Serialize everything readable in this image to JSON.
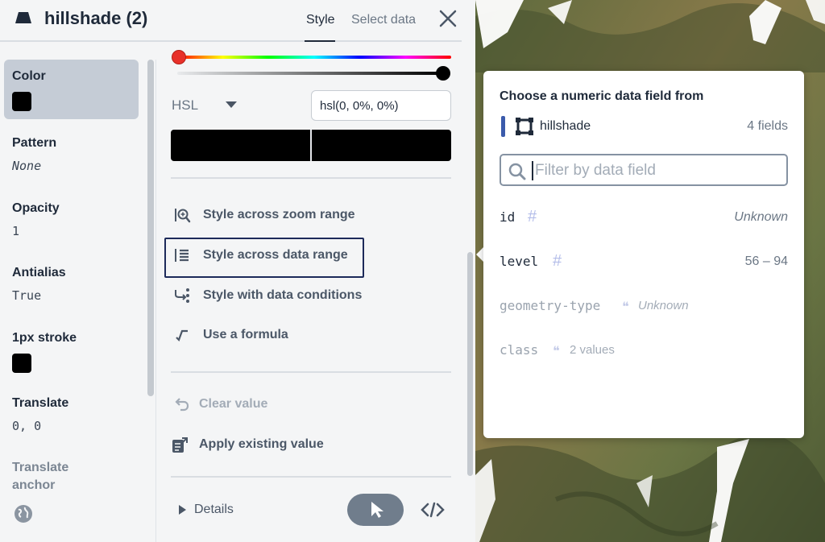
{
  "header": {
    "layer_title": "hillshade (2)",
    "tab_style": "Style",
    "tab_select_data": "Select data"
  },
  "sidebar": {
    "items": [
      {
        "label": "Color",
        "value": ""
      },
      {
        "label": "Pattern",
        "value": "None"
      },
      {
        "label": "Opacity",
        "value": "1"
      },
      {
        "label": "Antialias",
        "value": "True"
      },
      {
        "label": "1px stroke",
        "value": ""
      },
      {
        "label": "Translate",
        "value": "0, 0"
      },
      {
        "label": "Translate anchor",
        "value": ""
      }
    ]
  },
  "color_picker": {
    "mode": "HSL",
    "value": "hsl(0, 0%, 0%)",
    "hue": 0,
    "alpha": 1,
    "swatch_color": "#000000"
  },
  "actions": [
    "Style across zoom range",
    "Style across data range",
    "Style with data conditions",
    "Use a formula",
    "Clear value",
    "Apply existing value"
  ],
  "footer": {
    "details_label": "Details"
  },
  "popover": {
    "title": "Choose a numeric data field from",
    "source_name": "hillshade",
    "field_count": "4 fields",
    "filter_placeholder": "Filter by data field",
    "fields": [
      {
        "name": "id",
        "type_symbol": "#",
        "range": "Unknown"
      },
      {
        "name": "level",
        "type_symbol": "#",
        "range": "56 – 94"
      },
      {
        "name": "geometry-type",
        "type_symbol": "❝",
        "note": "Unknown"
      },
      {
        "name": "class",
        "type_symbol": "❝",
        "note": "2 values"
      }
    ]
  },
  "colors": {
    "accent_border": "#1d2a5a",
    "source_accent": "#3b5bab",
    "active_item_bg": "#c5ccd6"
  }
}
